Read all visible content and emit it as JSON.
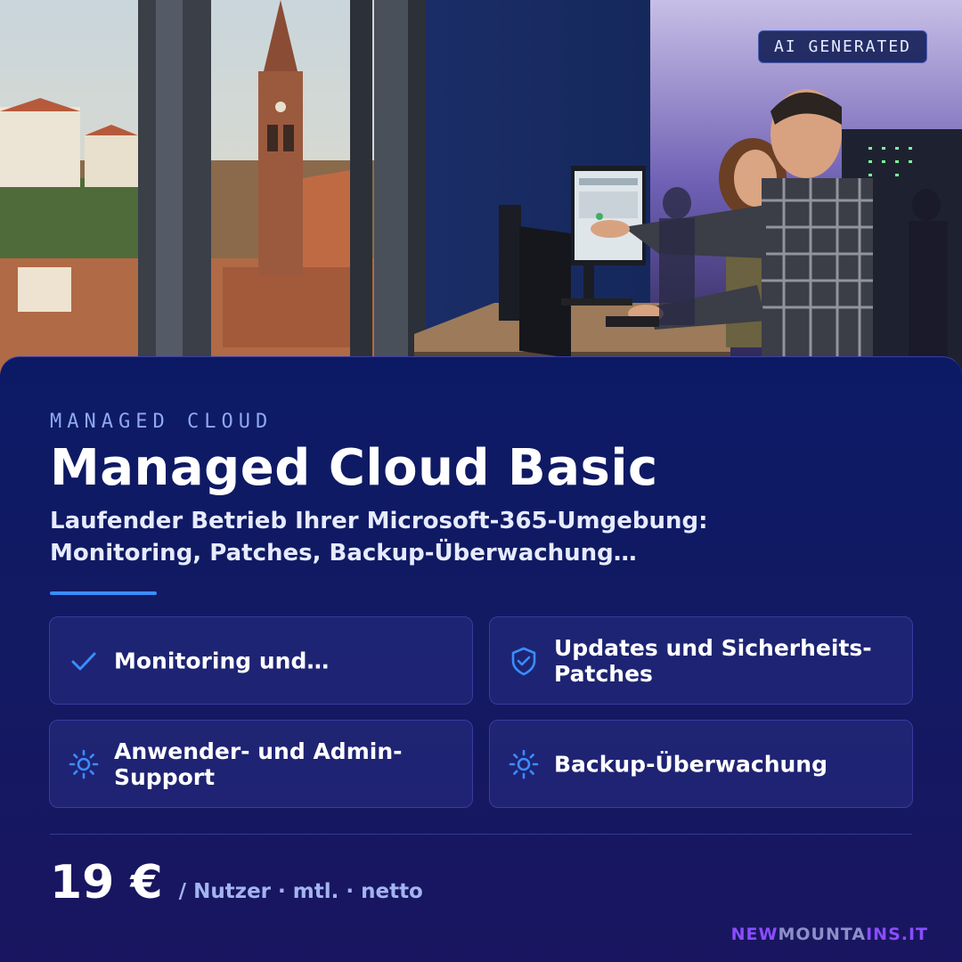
{
  "badge": {
    "label": "AI GENERATED"
  },
  "product": {
    "eyebrow": "MANAGED CLOUD",
    "title": "Managed Cloud Basic",
    "subtitle_line1": "Laufender Betrieb Ihrer Microsoft-365-Umgebung:",
    "subtitle_line2": "Monitoring, Patches, Backup-Überwachung…"
  },
  "features": [
    {
      "icon": "check-icon",
      "label": "Monitoring und…"
    },
    {
      "icon": "shield-check-icon",
      "label": "Updates und Sicherheits-Patches"
    },
    {
      "icon": "gear-icon",
      "label": "Anwender- und Admin-Support"
    },
    {
      "icon": "gear-icon",
      "label": "Backup-Überwachung"
    }
  ],
  "pricing": {
    "amount": "19 €",
    "unit": "/ Nutzer · mtl. · netto"
  },
  "brand": {
    "part1": "NEW",
    "part2": "MOUNTA",
    "part3": "INS.IT"
  },
  "colors": {
    "accent": "#3a8dff",
    "card_background": "#0c1a66",
    "brand_purple": "#8a4dff"
  }
}
